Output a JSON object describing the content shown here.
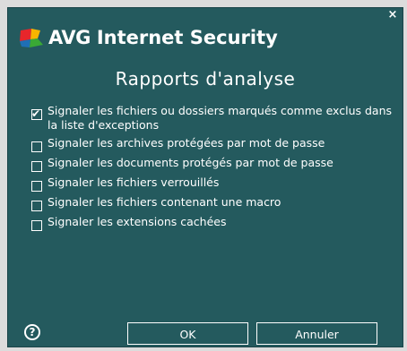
{
  "window": {
    "close_symbol": "×"
  },
  "brand": {
    "logo_name": "avg-logo-icon",
    "avg": "AVG",
    "product": "Internet Security"
  },
  "dialog": {
    "title": "Rapports d'analyse"
  },
  "options": [
    {
      "label": "Signaler les fichiers ou dossiers marqués comme exclus dans la liste d'exceptions",
      "checked": true
    },
    {
      "label": "Signaler les archives protégées par mot de passe",
      "checked": false
    },
    {
      "label": "Signaler les documents protégés par mot de passe",
      "checked": false
    },
    {
      "label": "Signaler les fichiers verrouillés",
      "checked": false
    },
    {
      "label": "Signaler les fichiers contenant une macro",
      "checked": false
    },
    {
      "label": "Signaler les extensions cachées",
      "checked": false
    }
  ],
  "footer": {
    "help_symbol": "?",
    "ok_label": "OK",
    "cancel_label": "Annuler"
  },
  "colors": {
    "background": "#245a5e",
    "text": "#ffffff",
    "logo_red": "#e8262b",
    "logo_yellow": "#f7b500",
    "logo_green": "#3aa935",
    "logo_blue": "#1f6fb5"
  }
}
